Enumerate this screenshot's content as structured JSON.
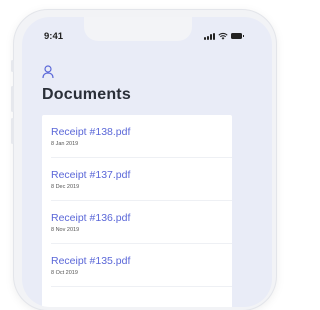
{
  "status_bar": {
    "time": "9:41",
    "signal_icon": "signal-icon",
    "wifi_icon": "wifi-icon",
    "battery_icon": "battery-icon"
  },
  "header": {
    "profile_icon": "user-icon",
    "title": "Documents"
  },
  "documents": [
    {
      "name": "Receipt #138.pdf",
      "date": "8 Jan 2019"
    },
    {
      "name": "Receipt #137.pdf",
      "date": "8 Dec 2019"
    },
    {
      "name": "Receipt #136.pdf",
      "date": "8 Nov 2019"
    },
    {
      "name": "Receipt #135.pdf",
      "date": "8 Oct 2019"
    }
  ],
  "colors": {
    "accent": "#5a67d8",
    "screen_bg": "#e9ecf7",
    "title": "#2a2f38"
  }
}
